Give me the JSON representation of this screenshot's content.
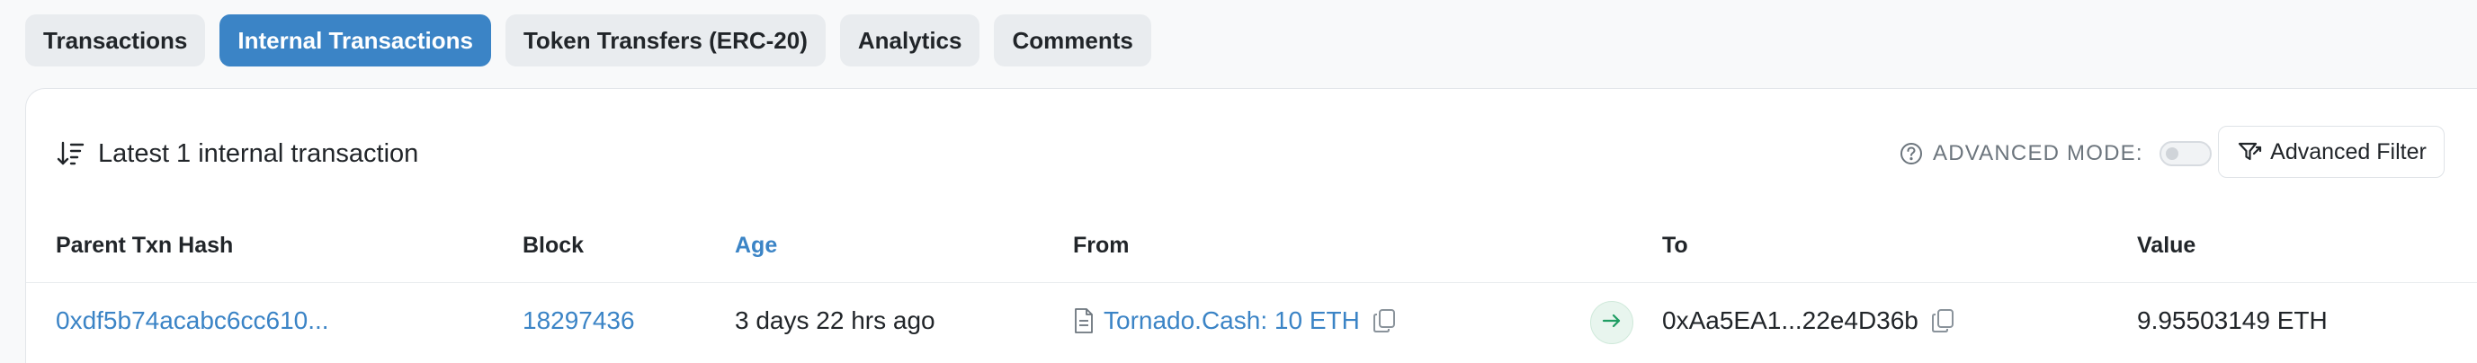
{
  "tabs": [
    {
      "label": "Transactions",
      "active": false
    },
    {
      "label": "Internal Transactions",
      "active": true
    },
    {
      "label": "Token Transfers (ERC-20)",
      "active": false
    },
    {
      "label": "Analytics",
      "active": false
    },
    {
      "label": "Comments",
      "active": false
    }
  ],
  "card": {
    "title": "Latest 1 internal transaction",
    "advanced_mode_label": "ADVANCED MODE:",
    "advanced_mode_on": false,
    "advanced_filter_label": "Advanced Filter"
  },
  "table": {
    "columns": [
      "Parent Txn Hash",
      "Block",
      "Age",
      "From",
      "To",
      "Value"
    ],
    "rows": [
      {
        "parent_txn_hash": "0xdf5b74acabc6cc610...",
        "block": "18297436",
        "age": "3 days 22 hrs ago",
        "from": "Tornado.Cash: 10 ETH",
        "to": "0xAa5EA1...22e4D36b",
        "value": "9.95503149 ETH"
      }
    ]
  },
  "icons": {
    "sort": "sort-descending-icon",
    "help": "question-circle-icon",
    "filter": "filter-icon",
    "contract": "document-icon",
    "copy": "copy-icon",
    "direction": "arrow-right-icon"
  },
  "colors": {
    "accent": "#3b84c6",
    "tab_inactive_bg": "#e9ecef",
    "direction_badge_bg": "#e8f5ee",
    "direction_arrow": "#1f9d63"
  }
}
